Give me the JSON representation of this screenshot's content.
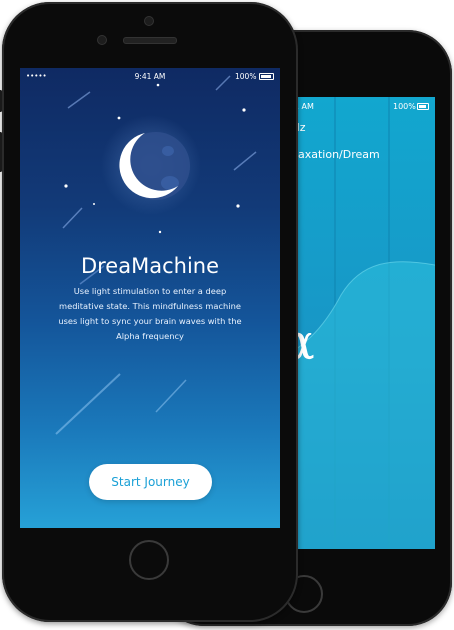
{
  "front": {
    "status": {
      "signal": "•••••",
      "time": "9:41 AM",
      "battery": "100%"
    },
    "title": "DreaMachine",
    "description": "Use light stimulation to enter a deep meditative state. This mindfulness machine uses light to sync your brain waves with the Alpha frequency",
    "cta_label": "Start Journey"
  },
  "back": {
    "status": {
      "time": "9:41 AM",
      "battery": "100%"
    },
    "frequency": "8 Hz",
    "state": "Relaxation/Dream",
    "wave_symbol": "α"
  },
  "colors": {
    "sky_top": "#0f2a63",
    "sky_bottom": "#26a1d7",
    "accent": "#1aa0d6",
    "back_screen": "#12a7cf"
  }
}
